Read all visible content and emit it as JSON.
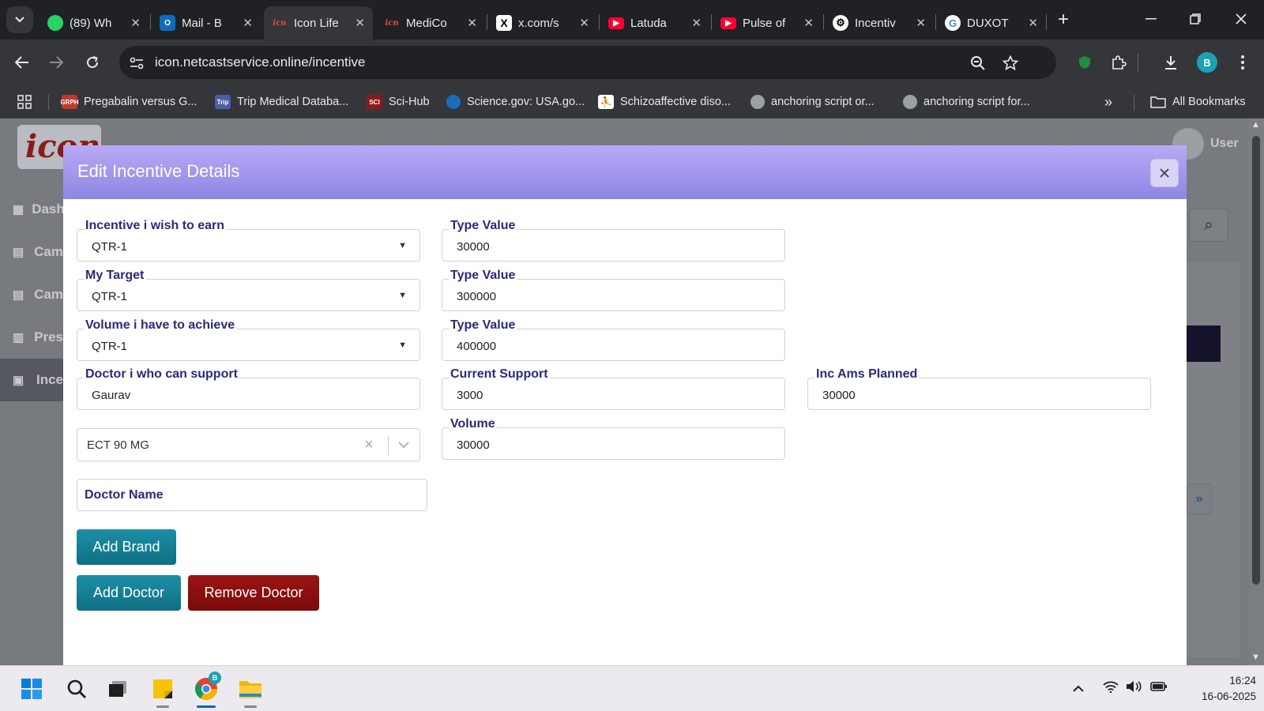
{
  "browser": {
    "tabs": [
      {
        "title": "(89) Wh",
        "favicon": "whatsapp-icon",
        "color": "#25d366",
        "badge": "89"
      },
      {
        "title": "Mail - B",
        "favicon": "outlook-icon",
        "color": "#0f6cbd"
      },
      {
        "title": "Icon Life",
        "favicon": "icon-lifescience-icon",
        "color": "#c0392b",
        "active": true
      },
      {
        "title": "MediCo",
        "favicon": "icon-lifescience-icon",
        "color": "#c0392b"
      },
      {
        "title": "x.com/s",
        "favicon": "x-icon",
        "color": "#000000"
      },
      {
        "title": "Latuda",
        "favicon": "youtube-icon",
        "color": "#ff0033"
      },
      {
        "title": "Pulse of",
        "favicon": "youtube-icon",
        "color": "#ff0033"
      },
      {
        "title": "Incentiv",
        "favicon": "chatgpt-icon",
        "color": "#ffffff"
      },
      {
        "title": "DUXOT",
        "favicon": "google-icon",
        "color": "#4285f4"
      }
    ],
    "url": "icon.netcastservice.online/incentive",
    "profile_initial": "B",
    "bookmarks": [
      {
        "label": "Pregabalin versus G...",
        "favicon": "grph-icon",
        "fav_text": "GRPH",
        "color": "#c0392b"
      },
      {
        "label": "Trip Medical Databa...",
        "favicon": "trip-icon",
        "fav_text": "Trip",
        "color": "#4a5fa8"
      },
      {
        "label": "Sci-Hub",
        "favicon": "scihub-icon",
        "fav_text": "SCI",
        "color": "#8b1a1a"
      },
      {
        "label": "Science.gov: USA.go...",
        "favicon": "sciencegov-icon",
        "fav_text": "",
        "color": "#1e6bb8"
      },
      {
        "label": "Schizoaffective diso...",
        "favicon": "figure-icon",
        "fav_text": "",
        "color": "#2a7de1"
      },
      {
        "label": "anchoring script or...",
        "favicon": "globe-icon",
        "fav_text": "",
        "color": "#5f6368"
      },
      {
        "label": "anchoring script for...",
        "favicon": "globe-icon",
        "fav_text": "",
        "color": "#5f6368"
      }
    ],
    "all_bookmarks": "All Bookmarks"
  },
  "page": {
    "logo_text": "icon",
    "user_label": "User",
    "sidebar": [
      {
        "label": "Dash",
        "icon": "grid-icon"
      },
      {
        "label": "Cam",
        "icon": "doc-icon"
      },
      {
        "label": "Cam",
        "icon": "doc-icon"
      },
      {
        "label": "Pres",
        "icon": "prescription-icon"
      },
      {
        "label": "Ince",
        "icon": "incentive-icon",
        "active": true
      }
    ]
  },
  "modal": {
    "title": "Edit Incentive Details",
    "fields": {
      "incentive_earn": {
        "label": "Incentive i wish to earn",
        "value": "QTR-1"
      },
      "type_value_1": {
        "label": "Type Value",
        "value": "30000"
      },
      "my_target": {
        "label": "My Target",
        "value": "QTR-1"
      },
      "type_value_2": {
        "label": "Type Value",
        "value": "300000"
      },
      "volume_achieve": {
        "label": "Volume i have to achieve",
        "value": "QTR-1"
      },
      "type_value_3": {
        "label": "Type Value",
        "value": "400000"
      },
      "doctor_support": {
        "label": "Doctor i who can support",
        "value": "Gaurav"
      },
      "current_support": {
        "label": "Current Support",
        "value": "3000"
      },
      "inc_ams_planned": {
        "label": "Inc Ams Planned",
        "value": "30000"
      },
      "brand": {
        "value": "ECT 90 MG"
      },
      "volume": {
        "label": "Volume",
        "value": "30000"
      },
      "doctor_name": {
        "placeholder": "Doctor Name"
      }
    },
    "buttons": {
      "add_brand": "Add Brand",
      "add_doctor": "Add Doctor",
      "remove_doctor": "Remove Doctor"
    }
  },
  "taskbar": {
    "time": "16:24",
    "date": "16-06-2025",
    "chrome_badge": "B"
  }
}
